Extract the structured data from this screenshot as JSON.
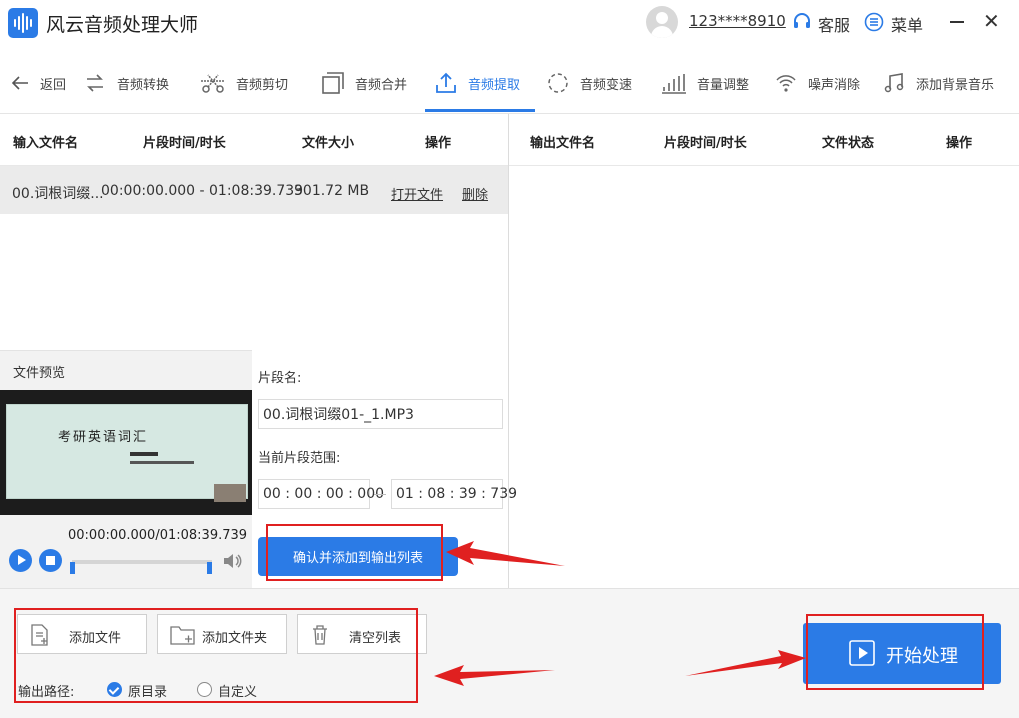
{
  "app": {
    "title": "风云音频处理大师",
    "user": "123****8910",
    "service": "客服",
    "menu": "菜单",
    "close": "✕"
  },
  "toolbar": {
    "back": "返回",
    "items": [
      "音频转换",
      "音频剪切",
      "音频合并",
      "音频提取",
      "音频变速",
      "音量调整",
      "噪声消除",
      "添加背景音乐"
    ],
    "active_index": 3
  },
  "input_table": {
    "headers": [
      "输入文件名",
      "片段时间/时长",
      "文件大小",
      "操作"
    ],
    "rows": [
      {
        "name": "00.词根词缀...",
        "time": "00:00:00.000 - 01:08:39.739",
        "size": "301.72 MB",
        "open": "打开文件",
        "delete": "删除"
      }
    ]
  },
  "output_table": {
    "headers": [
      "输出文件名",
      "片段时间/时长",
      "文件状态",
      "操作"
    ]
  },
  "preview": {
    "title": "文件预览",
    "thumb_title": "考研英语词汇",
    "time": "00:00:00.000/01:08:39.739",
    "progress": 0
  },
  "segment": {
    "name_label": "片段名:",
    "name_value": "00.词根词缀01-_1.MP3",
    "range_label": "当前片段范围:",
    "start": "00 : 00 : 00 : 000",
    "end": "01 : 08 : 39 : 739",
    "confirm": "确认并添加到输出列表"
  },
  "bottom": {
    "add_file": "添加文件",
    "add_folder": "添加文件夹",
    "clear": "清空列表",
    "output_path_label": "输出路径:",
    "option_original": "原目录",
    "option_custom": "自定义",
    "selected": "原目录",
    "start": "开始处理"
  },
  "colors": {
    "accent": "#2b7be6",
    "annotation": "#e02020"
  }
}
